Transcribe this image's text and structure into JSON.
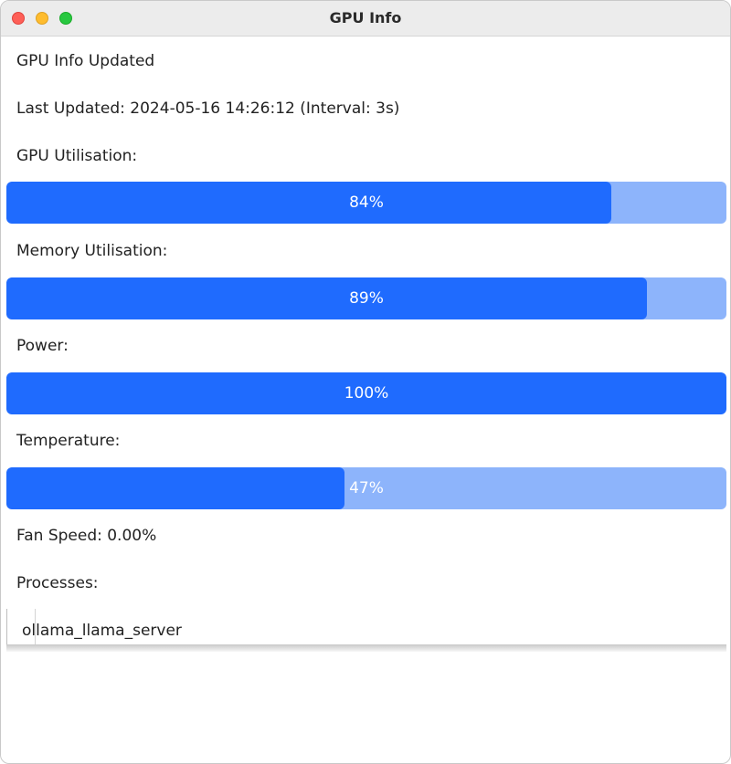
{
  "window": {
    "title": "GPU Info"
  },
  "status": "GPU Info Updated",
  "last_updated": "Last Updated: 2024-05-16 14:26:12 (Interval: 3s)",
  "metrics": {
    "gpu": {
      "label": "GPU Utilisation:",
      "value": 84,
      "text": "84%"
    },
    "memory": {
      "label": "Memory Utilisation:",
      "value": 89,
      "text": "89%"
    },
    "power": {
      "label": "Power:",
      "value": 100,
      "text": "100%"
    },
    "temperature": {
      "label": "Temperature:",
      "value": 47,
      "text": "47%"
    }
  },
  "fan_speed": "Fan Speed: 0.00%",
  "processes": {
    "label": "Processes:",
    "items": [
      "ollama_llama_server"
    ]
  },
  "colors": {
    "bar_fill": "#1f6bfe",
    "bar_track": "#8db4fb"
  }
}
